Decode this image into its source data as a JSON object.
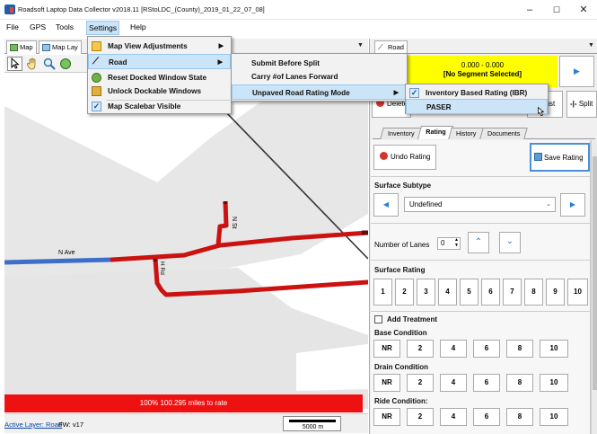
{
  "window": {
    "title": "Roadsoft Laptop Data Collector v2018.11 [RStoLDC_(County)_2019_01_22_07_08]",
    "controls": {
      "minimize": "–",
      "maximize": "☐",
      "close": "✕"
    }
  },
  "menubar": {
    "file": "File",
    "gps": "GPS",
    "tools": "Tools",
    "settings": "Settings",
    "help": "Help"
  },
  "left_panel": {
    "tabs": [
      {
        "label": "Map"
      },
      {
        "label": "Map Lay"
      }
    ],
    "map": {
      "road_labels": {
        "n_ave": "N Ave",
        "n_st": "N St",
        "h_rd": "H Rd"
      }
    },
    "rate_bar": "100% 100.295 miles to rate",
    "status": {
      "active_layer": "Active Layer: Road",
      "fw": "FW: v17",
      "scale": "5000 m"
    }
  },
  "settings_menu": {
    "items": [
      {
        "label": "Map View Adjustments",
        "has_submenu": true
      },
      {
        "label": "Road",
        "has_submenu": true,
        "highlighted": true
      },
      {
        "label": "Reset Docked Window State"
      },
      {
        "label": "Unlock Dockable Windows"
      },
      {
        "label": "Map Scalebar Visible",
        "checked": true
      }
    ]
  },
  "road_submenu": {
    "items": [
      {
        "label": "Submit Before Split"
      },
      {
        "label": "Carry #of Lanes Forward"
      },
      {
        "label": "Unpaved Road Rating Mode",
        "has_submenu": true,
        "highlighted": true
      }
    ]
  },
  "unpaved_submenu": {
    "items": [
      {
        "label": "Inventory Based Rating (IBR)",
        "checked": true
      },
      {
        "label": "PASER",
        "highlighted": true
      }
    ]
  },
  "right_panel": {
    "tab": "Road",
    "segment": {
      "range": "0.000 - 0.000",
      "status": "[No Segment Selected]"
    },
    "buttons": {
      "delete": "Delete",
      "adjust": "Adjust",
      "split": "Split"
    },
    "subtabs": [
      "Inventory",
      "Rating",
      "History",
      "Documents"
    ],
    "rating": {
      "undo": "Undo Rating",
      "save": "Save Rating",
      "surface_subtype_label": "Surface Subtype",
      "surface_subtype_value": "Undefined",
      "lanes_label": "Number of Lanes",
      "lanes_value": "0",
      "surface_rating_label": "Surface Rating",
      "surface_rating_values": [
        "1",
        "2",
        "3",
        "4",
        "5",
        "6",
        "7",
        "8",
        "9",
        "10"
      ],
      "add_treatment": "Add Treatment",
      "base_condition_label": "Base Condition",
      "base_condition_values": [
        "NR",
        "2",
        "4",
        "6",
        "8",
        "10"
      ],
      "drain_condition_label": "Drain Condition",
      "drain_condition_values": [
        "NR",
        "2",
        "4",
        "6",
        "8",
        "10"
      ],
      "ride_condition_label": "Ride Condition:",
      "ride_condition_values": [
        "NR",
        "2",
        "4",
        "6",
        "8",
        "10"
      ]
    }
  },
  "colors": {
    "road_red": "#cc1111",
    "road_blue": "#3e6fc8",
    "highlight_yellow": "#ffff00",
    "rate_bar_red": "#ee1111"
  }
}
